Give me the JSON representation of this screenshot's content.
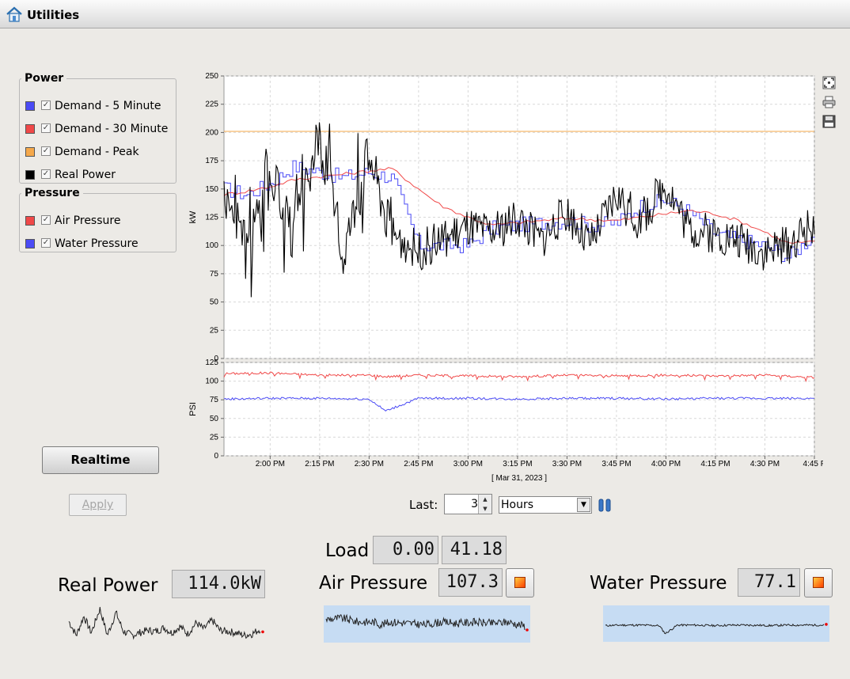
{
  "window": {
    "title": "Utilities"
  },
  "power_group": {
    "title": "Power",
    "items": [
      {
        "label": "Demand - 5 Minute",
        "color": "#4b4bf5",
        "checked": true
      },
      {
        "label": "Demand - 30 Minute",
        "color": "#f04848",
        "checked": true
      },
      {
        "label": "Demand - Peak",
        "color": "#f5a84a",
        "checked": true
      },
      {
        "label": "Real Power",
        "color": "#000000",
        "checked": true
      }
    ]
  },
  "pressure_group": {
    "title": "Pressure",
    "items": [
      {
        "label": "Air Pressure",
        "color": "#f04848",
        "checked": true
      },
      {
        "label": "Water Pressure",
        "color": "#4b4bf5",
        "checked": true
      }
    ]
  },
  "buttons": {
    "realtime": "Realtime",
    "apply": "Apply"
  },
  "range_controls": {
    "last_label": "Last:",
    "last_value": "3",
    "unit": "Hours",
    "unit_options": [
      "Hours"
    ]
  },
  "readouts": {
    "load_label": "Load",
    "load_value_1": "0.00",
    "load_value_2": "41.18",
    "real_power_label": "Real Power",
    "real_power_value": "114.0kW",
    "air_pressure_label": "Air Pressure",
    "air_pressure_value": "107.3",
    "water_pressure_label": "Water Pressure",
    "water_pressure_value": "77.1"
  },
  "icons": [
    "home-icon",
    "zoom-fit-icon",
    "print-icon",
    "save-icon",
    "pause-icon",
    "alarm-icon"
  ],
  "chart_data": [
    {
      "type": "line",
      "ylabel": "kW",
      "ylim": [
        0,
        250
      ],
      "yticks": [
        0,
        25,
        50,
        75,
        100,
        125,
        150,
        175,
        200,
        225,
        250
      ],
      "grid": true,
      "xlim": [
        "1:46 PM",
        "4:45 PM"
      ],
      "x": [
        "1:46 PM",
        "1:53 PM",
        "2:00 PM",
        "2:07 PM",
        "2:15 PM",
        "2:22 PM",
        "2:30 PM",
        "2:37 PM",
        "2:45 PM",
        "2:52 PM",
        "3:00 PM",
        "3:07 PM",
        "3:15 PM",
        "3:22 PM",
        "3:30 PM",
        "3:37 PM",
        "3:45 PM",
        "3:52 PM",
        "4:00 PM",
        "4:07 PM",
        "4:15 PM",
        "4:22 PM",
        "4:30 PM",
        "4:37 PM",
        "4:45 PM"
      ],
      "series": [
        {
          "name": "Demand - 5 Minute",
          "color": "#4b4bf5",
          "values": [
            150,
            145,
            155,
            170,
            165,
            160,
            165,
            160,
            100,
            100,
            100,
            115,
            118,
            120,
            122,
            118,
            120,
            135,
            140,
            130,
            110,
            105,
            100,
            90,
            110
          ]
        },
        {
          "name": "Demand - 30 Minute",
          "color": "#f04848",
          "values": [
            145,
            148,
            152,
            158,
            161,
            163,
            166,
            168,
            150,
            135,
            125,
            118,
            120,
            122,
            124,
            123,
            122,
            125,
            128,
            131,
            128,
            122,
            112,
            102,
            103
          ]
        },
        {
          "name": "Demand - Peak",
          "color": "#f5a84a",
          "values": [
            201,
            201,
            201,
            201,
            201,
            201,
            201,
            201,
            201,
            201,
            201,
            201,
            201,
            201,
            201,
            201,
            201,
            201,
            201,
            201,
            201,
            201,
            201,
            201,
            201
          ]
        },
        {
          "name": "Real Power",
          "color": "#000000",
          "values": [
            150,
            95,
            170,
            105,
            200,
            95,
            185,
            110,
            95,
            105,
            115,
            110,
            125,
            105,
            130,
            100,
            145,
            120,
            155,
            115,
            110,
            105,
            95,
            100,
            120
          ]
        }
      ]
    },
    {
      "type": "line",
      "ylabel": "PSI",
      "ylim": [
        0,
        125
      ],
      "yticks": [
        0,
        25,
        50,
        75,
        100,
        125
      ],
      "grid": true,
      "xlabel": "[ Mar 31, 2023 ]",
      "xticks": [
        "2:00 PM",
        "2:15 PM",
        "2:30 PM",
        "2:45 PM",
        "3:00 PM",
        "3:15 PM",
        "3:30 PM",
        "3:45 PM",
        "4:00 PM",
        "4:15 PM",
        "4:30 PM",
        "4:45 P"
      ],
      "xlim": [
        "1:46 PM",
        "4:45 PM"
      ],
      "x": [
        "1:46 PM",
        "2:00 PM",
        "2:15 PM",
        "2:30 PM",
        "2:35 PM",
        "2:45 PM",
        "3:00 PM",
        "3:15 PM",
        "3:30 PM",
        "3:45 PM",
        "4:00 PM",
        "4:15 PM",
        "4:30 PM",
        "4:45 PM"
      ],
      "series": [
        {
          "name": "Air Pressure",
          "color": "#f04848",
          "values": [
            110,
            111,
            108,
            108,
            106,
            108,
            107,
            106,
            108,
            107,
            108,
            107,
            108,
            105
          ]
        },
        {
          "name": "Water Pressure",
          "color": "#4b4bf5",
          "values": [
            76,
            77,
            77,
            76,
            60,
            77,
            77,
            76,
            77,
            77,
            76,
            77,
            77,
            77
          ]
        }
      ]
    }
  ]
}
